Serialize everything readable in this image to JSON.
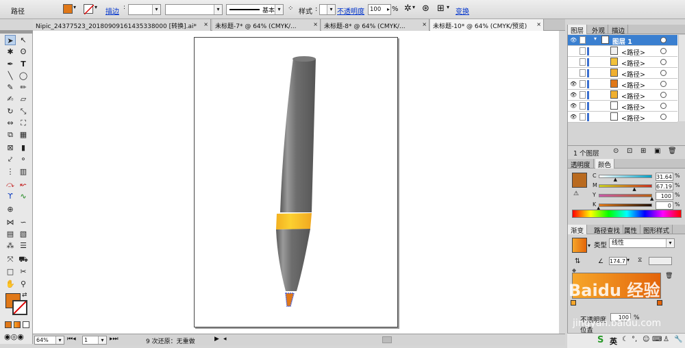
{
  "control_bar": {
    "object_type": "路径",
    "fill_color": "#e07818",
    "stroke_label": "描边",
    "stroke_weight": "",
    "brush_value": "",
    "stroke_profile": "基本",
    "style_label": "样式",
    "opacity_label": "不透明度",
    "opacity_value": "100",
    "opacity_unit": "%",
    "transform_label": "变换"
  },
  "tabs": [
    {
      "label": "Nipic_24377523_20180909161435338000 [转换].ai*",
      "active": false
    },
    {
      "label": "未标题-7* @ 64% (CMYK/...",
      "active": false
    },
    {
      "label": "未标题-8* @ 64% (CMYK/...",
      "active": false
    },
    {
      "label": "未标题-10* @ 64% (CMYK/预览)",
      "active": true
    }
  ],
  "status_bar": {
    "zoom": "64%",
    "artboard": "1",
    "undo_text": "9 次还原：无重做"
  },
  "layers_panel": {
    "tabs": [
      "图层",
      "外观",
      "描边"
    ],
    "layer_name": "图层 1",
    "rows": [
      {
        "label": "<路径>",
        "swatch": "#f2f2f2",
        "eye": false
      },
      {
        "label": "<路径>",
        "swatch": "#f2c23a",
        "eye": false
      },
      {
        "label": "<路径>",
        "swatch": "#f0b030",
        "eye": false
      },
      {
        "label": "<路径>",
        "swatch": "#e07818",
        "eye": true
      },
      {
        "label": "<路径>",
        "swatch": "#f0b030",
        "eye": true
      },
      {
        "label": "<路径>",
        "swatch": "#ffffff",
        "eye": true
      },
      {
        "label": "<路径>",
        "swatch": "#ffffff",
        "eye": true
      }
    ],
    "footer": "1 个图层"
  },
  "color_panel": {
    "tabs": [
      "透明度",
      "颜色"
    ],
    "channels": [
      {
        "name": "C",
        "value": "31.64",
        "from": "#ffffff",
        "to": "#00a0c6"
      },
      {
        "name": "M",
        "value": "67.19",
        "from": "#c8d020",
        "to": "#c83020"
      },
      {
        "name": "Y",
        "value": "100",
        "from": "#c858a8",
        "to": "#b86010"
      },
      {
        "name": "K",
        "value": "0",
        "from": "#e07818",
        "to": "#201008"
      }
    ],
    "current_color": "#b96a1f"
  },
  "gradient_panel": {
    "tabs": [
      "渐变",
      "路径查找",
      "属性",
      "图形样式"
    ],
    "type_label": "类型",
    "type_value": "线性",
    "angle": "174.7",
    "opacity_label": "不透明度",
    "opacity_value": "100",
    "opacity_unit": "%",
    "location_label": "位置",
    "gradient_from": "#f6a62a",
    "gradient_to": "#e3640a"
  },
  "watermark": "Baidu 经验",
  "watermark_url": "jingyan.baidu.com",
  "taskbar": {
    "ime_label": "英"
  }
}
